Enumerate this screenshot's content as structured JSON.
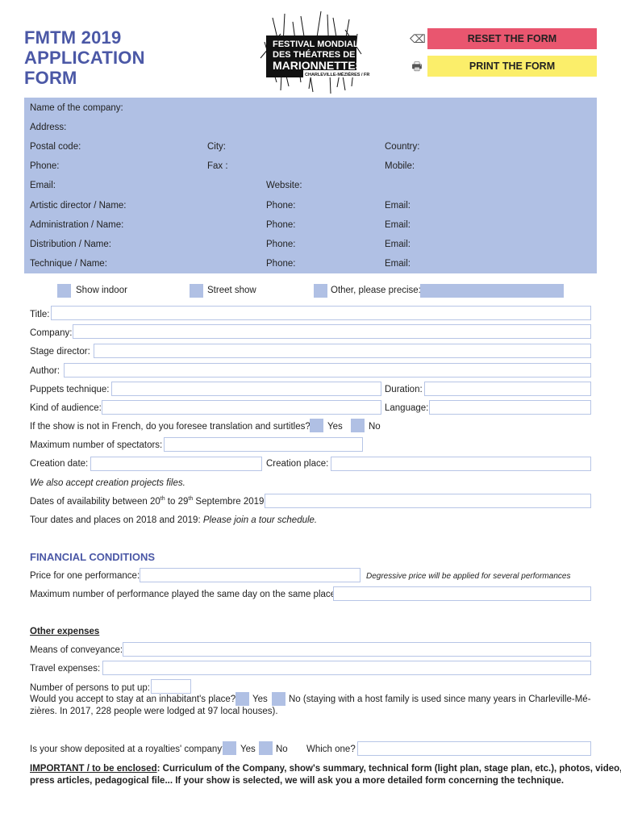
{
  "header": {
    "title_lines": [
      "FMTM 2019",
      "APPLICATION",
      "FORM"
    ],
    "logo": {
      "lines": [
        "FESTIVAL MONDIAL",
        "DES THÉATRES DE",
        "MARIONNETTES",
        "CHARLEVILLE-MÉZIÈRES / FRANCE"
      ]
    },
    "reset_button": "RESET THE FORM",
    "print_button": "PRINT THE FORM",
    "reset_icon": "backspace-icon",
    "print_icon": "printer-icon"
  },
  "company_panel": {
    "name": "Name of the company:",
    "address": "Address:",
    "postal_code": "Postal code:",
    "city": "City:",
    "country": "Country:",
    "phone": "Phone:",
    "fax": "Fax :",
    "mobile": "Mobile:",
    "email": "Email:",
    "website": "Website:",
    "contacts": [
      {
        "role": "Artistic director / Name:",
        "phone": "Phone:",
        "email": "Email:"
      },
      {
        "role": "Administration / Name:",
        "phone": "Phone:",
        "email": "Email:"
      },
      {
        "role": "Distribution / Name:",
        "phone": "Phone:",
        "email": "Email:"
      },
      {
        "role": "Technique / Name:",
        "phone": "Phone:",
        "email": "Email:"
      }
    ]
  },
  "show_type": {
    "indoor": "Show indoor",
    "street": "Street show",
    "other": "Other, please precise:"
  },
  "show": {
    "title": "Title:",
    "company": "Company:",
    "stage_director": "Stage director:",
    "author": "Author:",
    "puppets_technique": "Puppets technique:",
    "duration": "Duration:",
    "audience": "Kind of audience:",
    "language": "Language:",
    "translation_q": "If the show is not in French, do you foresee translation and surtitles?",
    "yes": "Yes",
    "no": "No",
    "max_spectators": "Maximum number of spectators:",
    "creation_date": "Creation date:",
    "creation_place": "Creation place:",
    "projects_note": "We also accept creation projects files.",
    "availability_pre": "Dates of availability between 20",
    "availability_sup1": "th",
    "availability_mid": " to 29",
    "availability_sup2": "th",
    "availability_post": " Septembre 2019:",
    "tour_dates": "Tour dates and places on 2018 and 2019: ",
    "tour_note": "Please join a tour schedule."
  },
  "financial": {
    "heading": "FINANCIAL CONDITIONS",
    "price": "Price for one performance:",
    "price_note": "Degressive price will be applied for several performances",
    "max_perf": "Maximum number of performance played the same day on the same place:"
  },
  "expenses": {
    "heading": "Other expenses",
    "conveyance": "Means of conveyance:",
    "travel": "Travel expenses:",
    "persons": "Number of persons to put up:",
    "inhabitant_q": "Would you accept to stay at an inhabitant's place?",
    "yes": "Yes",
    "no_note_1": "No (staying with a host family is used since many years in Charleville-Mé-",
    "no_note_2": "zières. In 2017, 228 people were lodged at 97 local houses)."
  },
  "royalties": {
    "question": "Is your show deposited at a royalties' company?",
    "yes": "Yes",
    "no": "No",
    "which": "Which one?"
  },
  "important": {
    "label": "IMPORTANT / to be enclosed",
    "text_1": ": Curriculum of the Company, show's summary, technical form (light plan, stage plan, etc.), photos, video,",
    "text_2": "press articles, pedagogical file... If your show is selected, we will ask you a more detailed form concerning the technique."
  },
  "colors": {
    "accent": "#4b58a6",
    "field_blue": "#b0c0e4",
    "reset": "#e9566f",
    "print": "#fbee6a"
  }
}
